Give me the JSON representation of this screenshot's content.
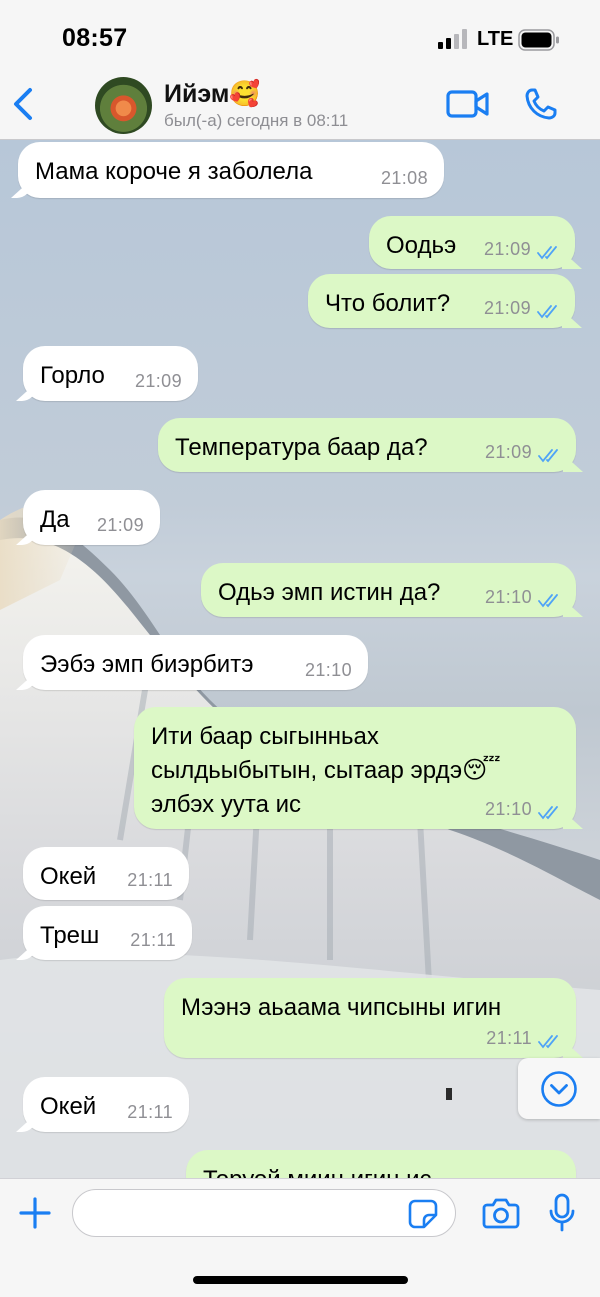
{
  "status_bar": {
    "time": "08:57",
    "network": "LTE"
  },
  "header": {
    "contact_name": "Ийэм🥰",
    "last_seen": "был(-а) сегодня в 08:11"
  },
  "messages": [
    {
      "dir": "in",
      "text": "Мама короче я заболела",
      "time": "21:08"
    },
    {
      "dir": "out",
      "text": "Оодьэ",
      "time": "21:09"
    },
    {
      "dir": "out",
      "text": "Что болит?",
      "time": "21:09"
    },
    {
      "dir": "in",
      "text": "Горло",
      "time": "21:09"
    },
    {
      "dir": "out",
      "text": "Температура баар да?",
      "time": "21:09"
    },
    {
      "dir": "in",
      "text": "Да",
      "time": "21:09"
    },
    {
      "dir": "out",
      "text": "Одьэ эмп истин да?",
      "time": "21:10"
    },
    {
      "dir": "in",
      "text": "Ээбэ эмп биэрбитэ",
      "time": "21:10"
    },
    {
      "dir": "out",
      "text": "Ити баар сыгынньах\nсылдьыбытын, сытаар эрдэ😴\nэлбэх уута ис",
      "time": "21:10"
    },
    {
      "dir": "in",
      "text": "Окей",
      "time": "21:11"
    },
    {
      "dir": "in",
      "text": "Треш",
      "time": "21:11"
    },
    {
      "dir": "out",
      "text": "Мээнэ аьаама чипсыны игин",
      "time": "21:11"
    },
    {
      "dir": "in",
      "text": "Окей",
      "time": "21:11"
    },
    {
      "dir": "out",
      "text": "Торуой миин игин ис",
      "time": ""
    }
  ],
  "input": {
    "placeholder": ""
  },
  "icons": {
    "back": "chevron-left-icon",
    "video": "video-camera-icon",
    "call": "phone-icon",
    "attach": "plus-icon",
    "sticker": "sticker-icon",
    "camera": "camera-icon",
    "voice": "microphone-icon",
    "scroll": "chevron-down-circle-icon",
    "read": "double-check-icon"
  },
  "colors": {
    "accent": "#1a7ef2",
    "outgoing_bubble": "#dcf8c6",
    "incoming_bubble": "#ffffff",
    "read_ticks": "#4fa3f7"
  }
}
